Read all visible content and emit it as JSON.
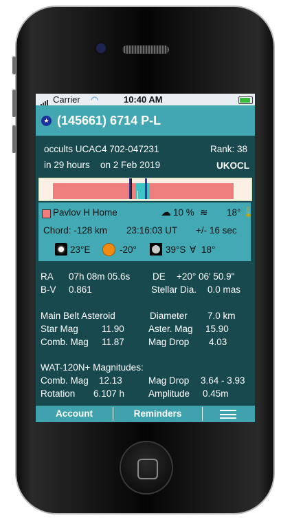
{
  "status": {
    "carrier": "Carrier",
    "time": "10:40 AM"
  },
  "title": {
    "text": "(145661) 6714 P-L"
  },
  "event": {
    "occults": "occults UCAC4 702-047231",
    "rank": "Rank: 38",
    "when": "in 29 hours",
    "date": "on 2 Feb 2019",
    "station_code": "UKOCL"
  },
  "observer": {
    "name": "Pavlov H Home",
    "cloud": "10 %",
    "temp": "18°",
    "chord": "Chord: -128 km",
    "time_ut": "23:16:03 UT",
    "uncertainty": "+/- 16 sec",
    "star_alt": "23°E",
    "sun_alt": "-20°",
    "moon": "39°S",
    "moon_phase": "18°"
  },
  "coords": {
    "ra_label": "RA",
    "ra_value": "07h 08m 05.6s",
    "de_label": "DE",
    "de_value": "+20° 06'   50.9\"",
    "bv_label": "B-V",
    "bv_value": "0.861",
    "stellar_label": "Stellar Dia.",
    "stellar_value": "0.0 mas"
  },
  "asteroid": {
    "type": "Main Belt Asteroid",
    "diameter_label": "Diameter",
    "diameter_value": "7.0 km",
    "star_mag_label": "Star Mag",
    "star_mag_value": "11.90",
    "aster_mag_label": "Aster. Mag",
    "aster_mag_value": "15.90",
    "comb_mag_label": "Comb. Mag",
    "comb_mag_value": "11.87",
    "mag_drop_label": "Mag Drop",
    "mag_drop_value": "4.03"
  },
  "wat": {
    "heading": "WAT-120N+ Magnitudes:",
    "comb_mag_label": "Comb. Mag",
    "comb_mag_value": "12.13",
    "mag_drop_label": "Mag Drop",
    "mag_drop_value": "3.64 - 3.93",
    "rotation_label": "Rotation",
    "rotation_value": "6.107 h",
    "amplitude_label": "Amplitude",
    "amplitude_value": "0.45m"
  },
  "nav": {
    "account": "Account",
    "reminders": "Reminders"
  },
  "colors": {
    "background": "#18494f",
    "accent": "#42a7b1",
    "path_red": "#ee7e7e",
    "path_cyan": "#3cc4c6"
  }
}
